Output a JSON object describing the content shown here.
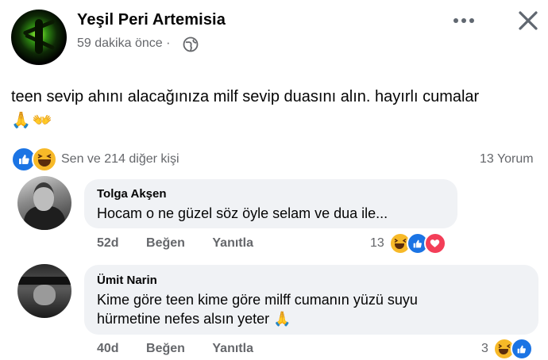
{
  "post": {
    "author": "Yeşil Peri Artemisia",
    "time": "59 dakika önce",
    "time_separator": "·",
    "privacy_icon": "globe-icon",
    "text": "teen sevip ahını alacağınıza milf sevip duasını alın. hayırlı cumalar",
    "emojis": "🙏👐",
    "reactions": {
      "types": [
        "like",
        "haha"
      ],
      "summary": "Sen ve 214 diğer kişi"
    },
    "comments_count": "13 Yorum"
  },
  "comments": [
    {
      "name": "Tolga Akşen",
      "text": "Hocam o ne güzel söz öyle selam ve dua ile...",
      "age": "52d",
      "like_label": "Beğen",
      "reply_label": "Yanıtla",
      "reaction_count": "13",
      "reaction_types": [
        "haha",
        "like",
        "love"
      ]
    },
    {
      "name": "Ümit Narin",
      "text_line1": "Kime göre teen kime göre milff cumanın yüzü suyu",
      "text_line2": "hürmetine nefes alsın yeter 🙏",
      "age": "40d",
      "like_label": "Beğen",
      "reply_label": "Yanıtla",
      "reaction_count": "3",
      "reaction_types": [
        "haha",
        "like"
      ]
    }
  ],
  "colors": {
    "like": "#1b74e4",
    "haha": "#f7b928",
    "love": "#f33e58",
    "secondary_text": "#65676b",
    "bubble": "#f0f2f5"
  }
}
